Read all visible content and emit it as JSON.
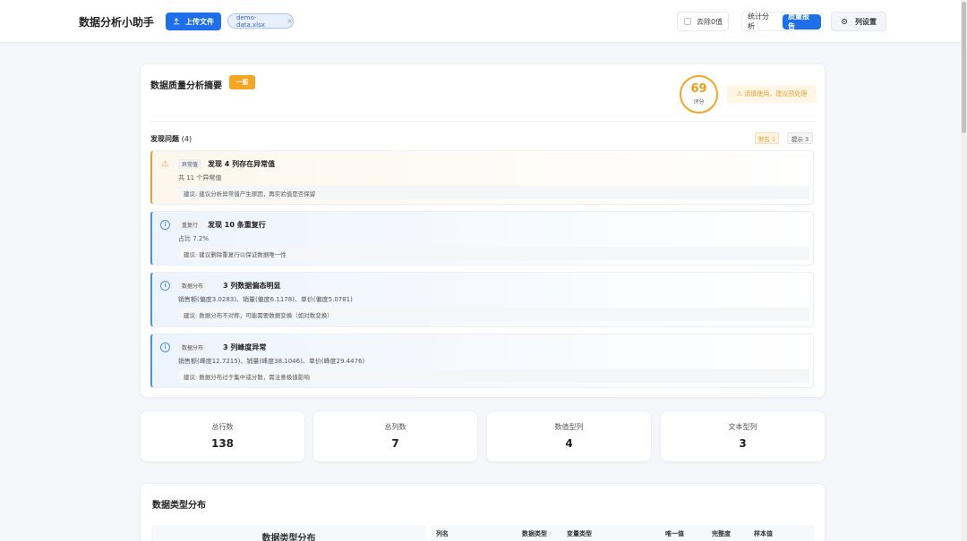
{
  "header": {
    "app_title": "数据分析小助手",
    "upload_label": "上传文件",
    "file_name": "demo-data.xlsx",
    "remove_zero_label": "去除0值",
    "tabs": [
      {
        "label": "统计分析",
        "active": false
      },
      {
        "label": "质量报告",
        "active": true
      }
    ],
    "column_settings_label": "列设置"
  },
  "quality": {
    "title": "数据质量分析摘要",
    "grade": "一般",
    "score": "69",
    "score_label": "评分",
    "note": "⚠ 请慎使用，建议预处理",
    "issues_title": "发现问题",
    "issues_count": "(4)",
    "warn_count": "警告 1",
    "tip_count": "提示 3",
    "issues": [
      {
        "level": "warn",
        "tag": "异常值",
        "title": "发现 4 列存在异常值",
        "detail": "共 11 个异常值",
        "suggestion": "建议: 建议分析异常值产生原因，再实验值是否保留"
      },
      {
        "level": "info",
        "tag": "重复行",
        "title": "发现 10 条重复行",
        "detail": "占比 7.2%",
        "suggestion": "建议: 建议删除重复行以保证数据唯一性"
      },
      {
        "level": "info",
        "tag": "数据分布",
        "title": "3 列数据偏态明显",
        "detail": "销售额(偏度3.0283)、销量(偏度6.1178)、单价(偏度5.0781)",
        "suggestion": "建议: 数据分布不对称，可能需要数据变换（如对数变换）"
      },
      {
        "level": "info",
        "tag": "数据分布",
        "title": "3 列峰度异常",
        "detail": "销售额(峰度12.7215)、销量(峰度38.1046)、单价(峰度29.4476)",
        "suggestion": "建议: 数据分布过于集中或分散，需注意极值影响"
      }
    ]
  },
  "stats": [
    {
      "label": "总行数",
      "value": "138"
    },
    {
      "label": "总列数",
      "value": "7"
    },
    {
      "label": "数值型列",
      "value": "4"
    },
    {
      "label": "文本型列",
      "value": "3"
    }
  ],
  "distribution": {
    "title": "数据类型分布",
    "chart_title": "数据类型分布",
    "columns": [
      "列名",
      "数据类型",
      "变量类型",
      "唯一值",
      "完整度",
      "样本值"
    ]
  },
  "icons": {
    "upload": "upload-icon",
    "gear": "gear-icon",
    "warning": "warning-icon",
    "info": "info-icon"
  },
  "colors": {
    "primary": "#1f6feb",
    "warning": "#e6a23c",
    "info": "#4a90e2",
    "grade": "#f6a623"
  }
}
